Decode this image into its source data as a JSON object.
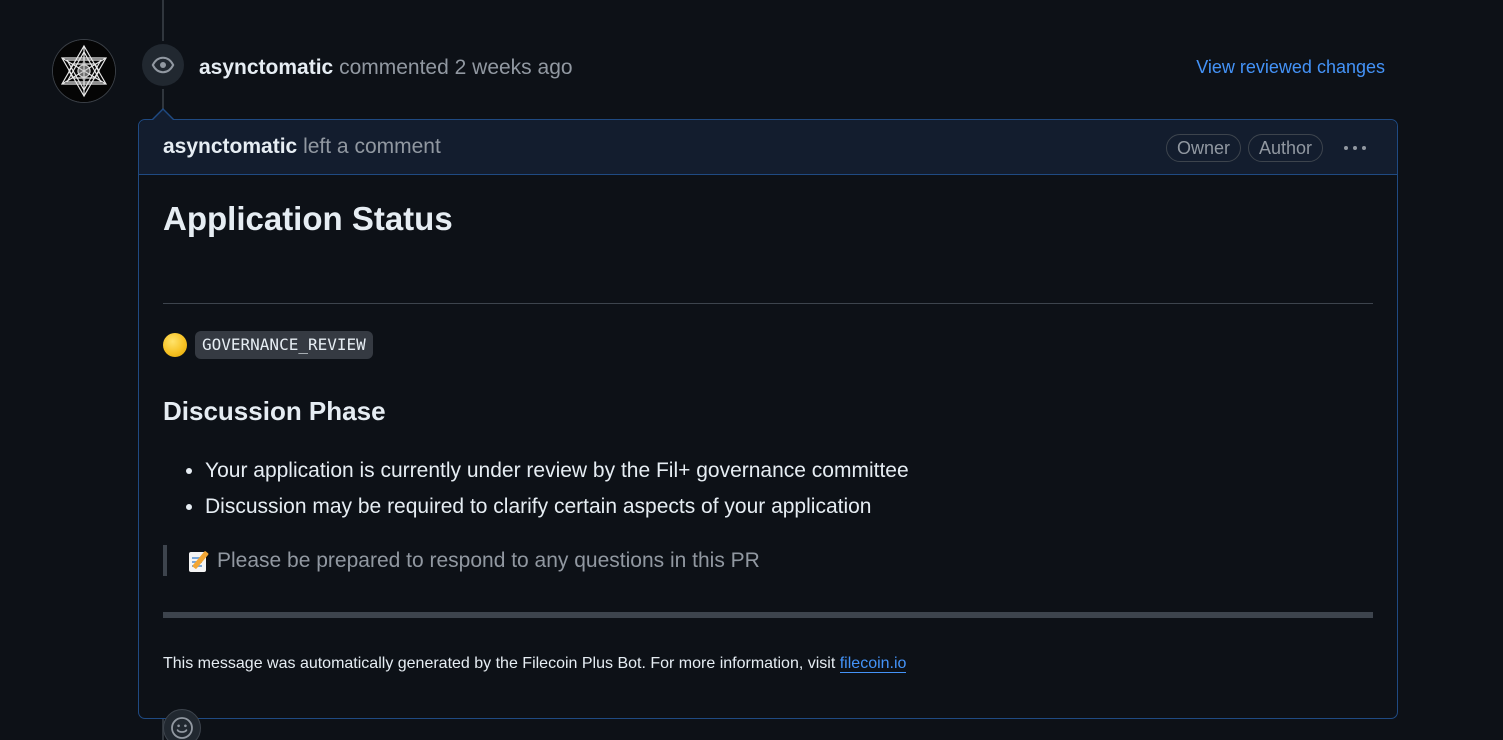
{
  "timeline_event": {
    "author": "asynctomatic",
    "action": "commented",
    "time": "2 weeks ago",
    "view_link": "View reviewed changes",
    "avatar_icon": "avatar-image",
    "event_icon": "eye-icon"
  },
  "comment": {
    "header": {
      "author": "asynctomatic",
      "action": "left a comment",
      "labels": [
        "Owner",
        "Author"
      ],
      "menu_icon": "kebab-horizontal-icon"
    },
    "body": {
      "h1": "Application Status",
      "status_emoji": "yellow-circle-icon",
      "status_code": "GOVERNANCE_REVIEW",
      "h2": "Discussion Phase",
      "list": [
        "Your application is currently under review by the Fil+ governance committee",
        "Discussion may be required to clarify certain aspects of your application"
      ],
      "quote_emoji": "memo-icon",
      "quote": "Please be prepared to respond to any questions in this PR",
      "footnote_text": "This message was automatically generated by the Filecoin Plus Bot. For more information, visit ",
      "footnote_link": "filecoin.io"
    },
    "reaction_icon": "smiley-icon"
  },
  "colors": {
    "background": "#0d1117",
    "link": "#4493f8",
    "border_accent": "#1f4a82",
    "muted_text": "#9198a1"
  }
}
